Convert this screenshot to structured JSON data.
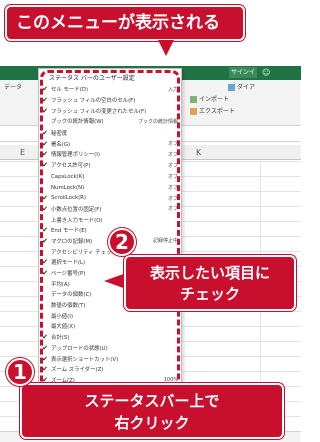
{
  "excel": {
    "signin_label": "サインイン",
    "ribbon_tab_data": "データ",
    "ribbon_right_1": "ダイア",
    "ribbon_right_2": "インポート",
    "ribbon_right_3": "エクスポート",
    "col_E": "E",
    "col_K": "K",
    "accent_color": "#217346"
  },
  "menu": {
    "title": "ステータス バーのユーザー設定",
    "items": [
      {
        "check": "✔",
        "label": "セル モード(D)",
        "value": "入力"
      },
      {
        "check": "✔",
        "label": "フラッシュ フィルの空白のセル(F)",
        "value": ""
      },
      {
        "check": "✔",
        "label": "フラッシュ フィルの変更されたセル(F)",
        "value": ""
      },
      {
        "check": "",
        "label": "ブックの統計情報(W)",
        "value": "ブックの統計情報"
      },
      {
        "check": "✔",
        "label": "秘密度",
        "value": ""
      },
      {
        "check": "✔",
        "label": "署名(G)",
        "value": "オフ"
      },
      {
        "check": "✔",
        "label": "情報管理ポリシー(I)",
        "value": "オフ"
      },
      {
        "check": "✔",
        "label": "アクセス許可(P)",
        "value": "オフ"
      },
      {
        "check": "",
        "label": "CapsLock(K)",
        "value": "オフ"
      },
      {
        "check": "",
        "label": "NumLock(N)",
        "value": "オフ"
      },
      {
        "check": "✔",
        "label": "ScrollLock(R)",
        "value": "オフ"
      },
      {
        "check": "✔",
        "label": "小数点位置の固定(F)",
        "value": "オフ"
      },
      {
        "check": "",
        "label": "上書き入力モード(O)",
        "value": ""
      },
      {
        "check": "✔",
        "label": "End モード(E)",
        "value": ""
      },
      {
        "check": "✔",
        "label": "マクロの記録(M)",
        "value": "記録停止中"
      },
      {
        "check": "",
        "label": "アクセシビリティ チェック",
        "value": ""
      },
      {
        "check": "✔",
        "label": "選択モード(L)",
        "value": ""
      },
      {
        "check": "✔",
        "label": "ページ番号(P)",
        "value": ""
      },
      {
        "check": "",
        "label": "平均(A)",
        "value": ""
      },
      {
        "check": "",
        "label": "データの個数(C)",
        "value": ""
      },
      {
        "check": "",
        "label": "数値の個数(T)",
        "value": ""
      },
      {
        "check": "",
        "label": "最小値(I)",
        "value": ""
      },
      {
        "check": "",
        "label": "最大値(X)",
        "value": ""
      },
      {
        "check": "✔",
        "label": "合計(S)",
        "value": ""
      },
      {
        "check": "✔",
        "label": "アップロードの状態(U)",
        "value": ""
      },
      {
        "check": "✔",
        "label": "表示選択ショートカット(V)",
        "value": ""
      },
      {
        "check": "✔",
        "label": "ズーム スライダー(Z)",
        "value": ""
      },
      {
        "check": "✔",
        "label": "ズーム(Z)",
        "value": "100%"
      }
    ]
  },
  "callouts": {
    "top_text": "このメニューが表示される",
    "mid_number": "2",
    "mid_line1": "表示したい項目に",
    "mid_line2": "チェック",
    "bottom_number": "1",
    "bottom_line1": "ステータスバー上で",
    "bottom_line2": "右クリック",
    "color": "#c8102e"
  }
}
